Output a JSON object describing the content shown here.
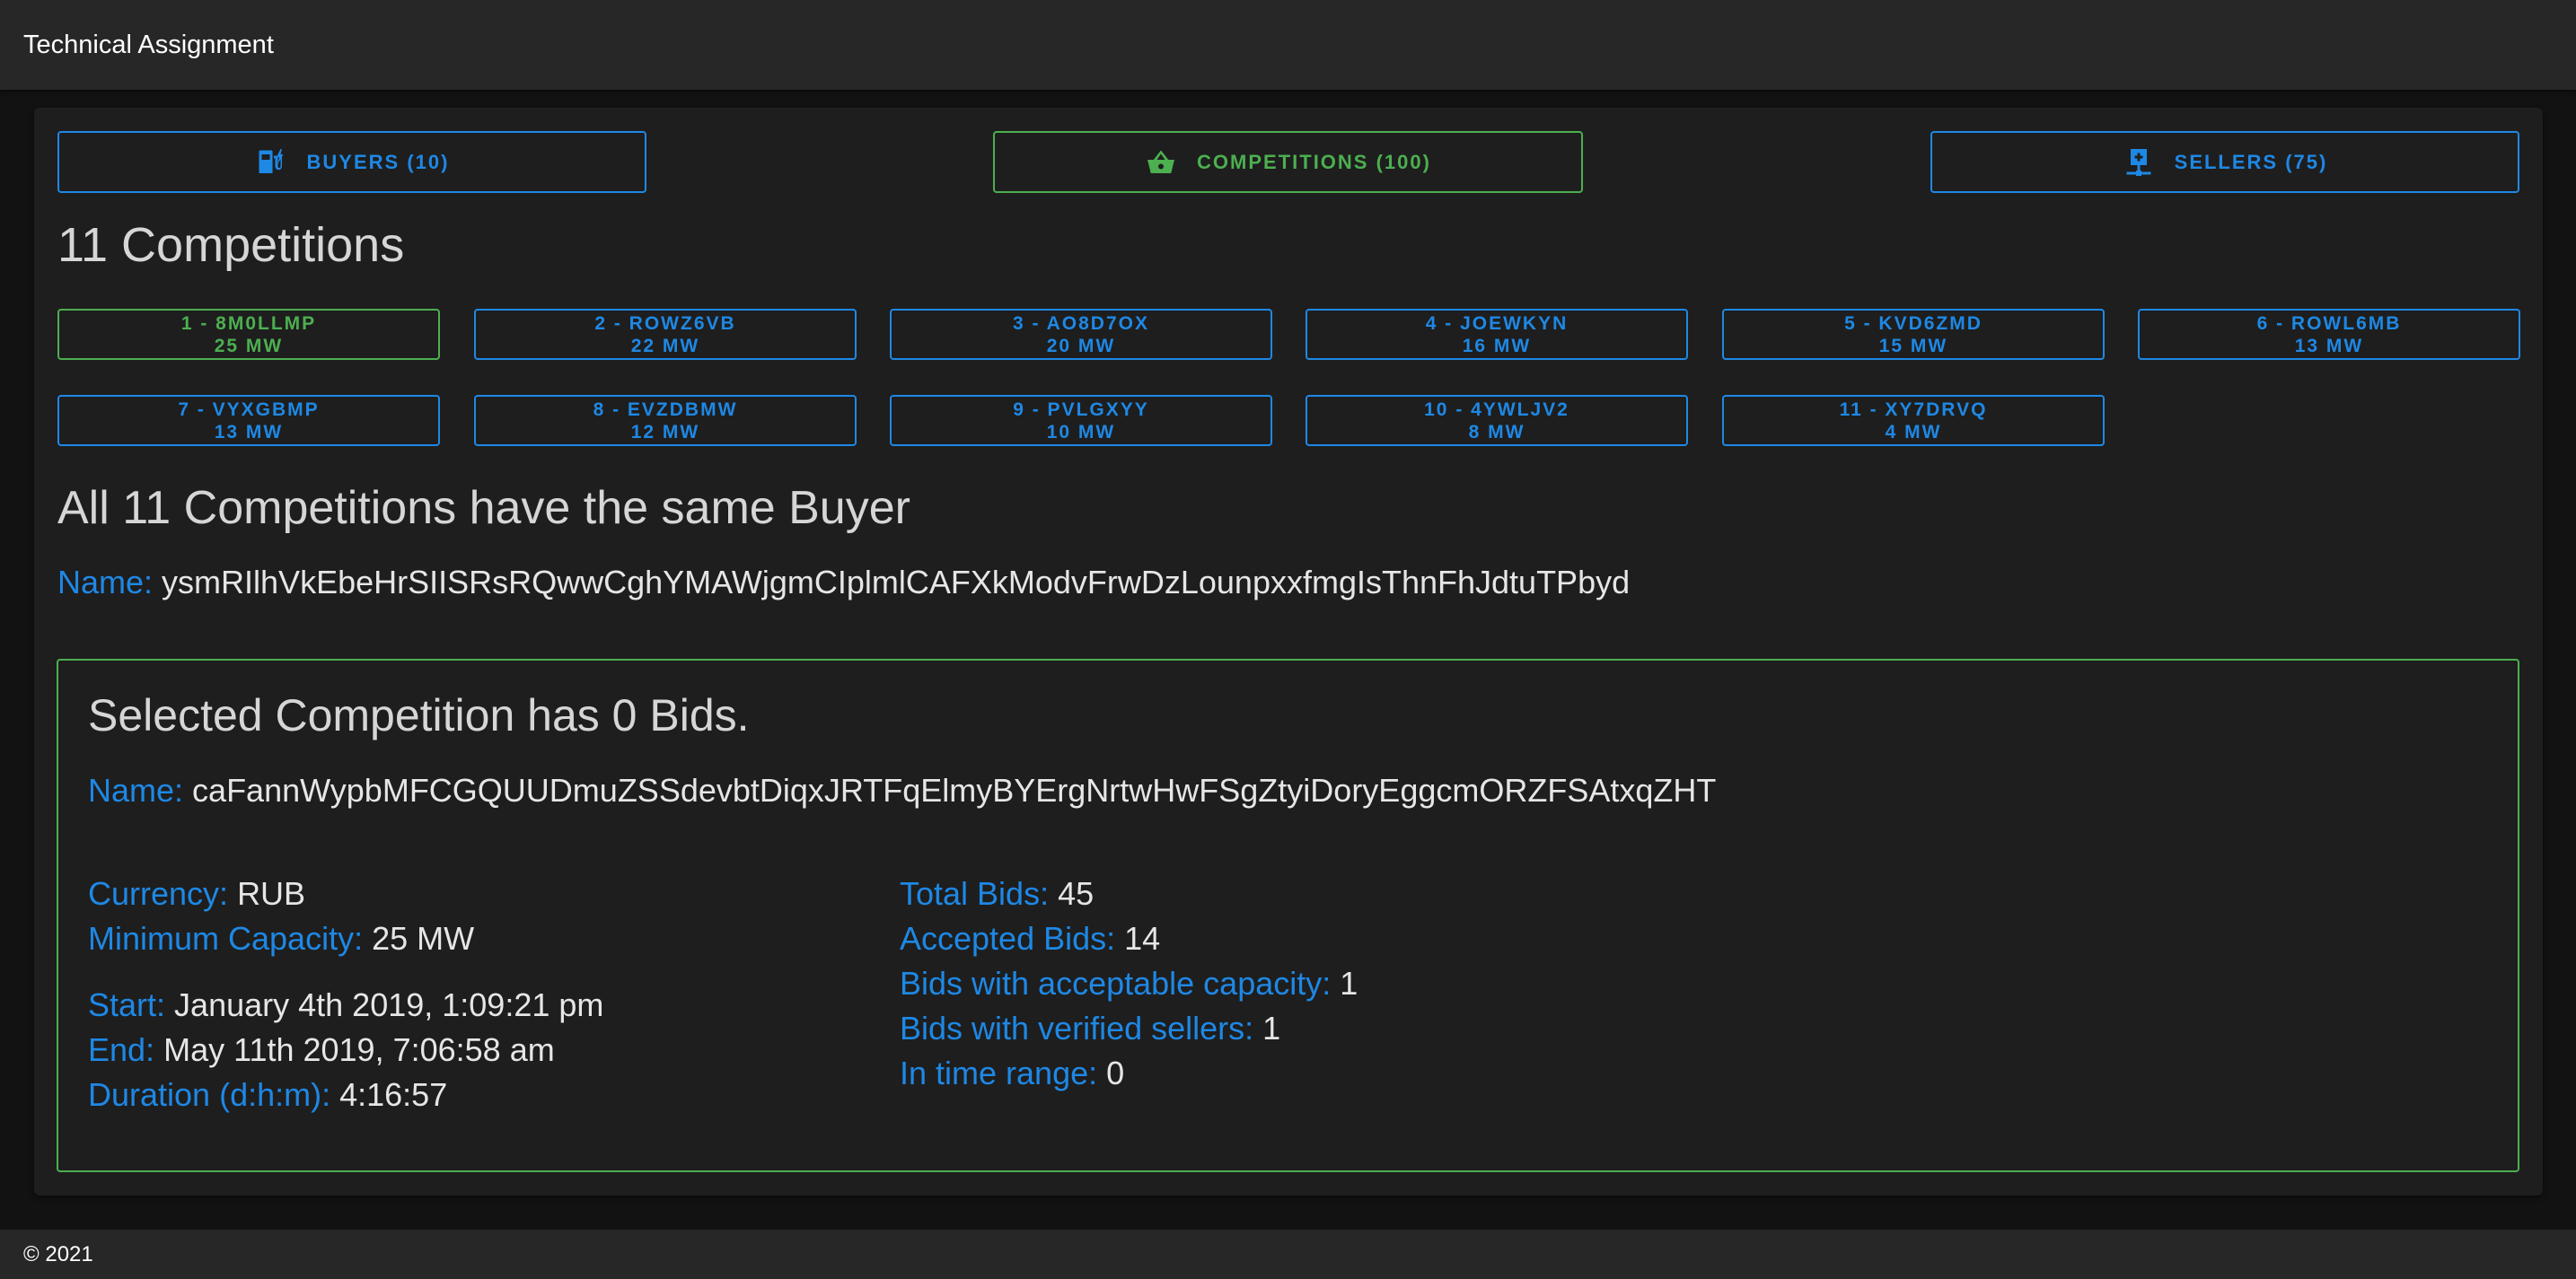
{
  "app": {
    "title": "Technical Assignment"
  },
  "footer": {
    "text": "© 2021"
  },
  "nav": {
    "buyers": {
      "label": "BUYERS (10)",
      "icon": "ev-charger-icon"
    },
    "competitions": {
      "label": "COMPETITIONS (100)",
      "icon": "basket-icon",
      "active": true
    },
    "sellers": {
      "label": "SELLERS (75)",
      "icon": "add-to-network-icon"
    }
  },
  "competitions_heading": "11 Competitions",
  "competitions": [
    {
      "title": "1 - 8M0LLMP",
      "capacity": "25 MW",
      "active": true
    },
    {
      "title": "2 - ROWZ6VB",
      "capacity": "22 MW"
    },
    {
      "title": "3 - AO8D7OX",
      "capacity": "20 MW"
    },
    {
      "title": "4 - JOEWKYN",
      "capacity": "16 MW"
    },
    {
      "title": "5 - KVD6ZMD",
      "capacity": "15 MW"
    },
    {
      "title": "6 - ROWL6MB",
      "capacity": "13 MW"
    },
    {
      "title": "7 - VYXGBMP",
      "capacity": "13 MW"
    },
    {
      "title": "8 - EVZDBMW",
      "capacity": "12 MW"
    },
    {
      "title": "9 - PVLGXYY",
      "capacity": "10 MW"
    },
    {
      "title": "10 - 4YWLJV2",
      "capacity": "8 MW"
    },
    {
      "title": "11 - XY7DRVQ",
      "capacity": "4 MW"
    }
  ],
  "buyer": {
    "heading": "All 11 Competitions have the same Buyer",
    "name_label": "Name:",
    "name_value": "ysmRIlhVkEbeHrSIISRsRQwwCghYMAWjgmCIplmlCAFXkModvFrwDzLounpxxfmgIsThnFhJdtuTPbyd"
  },
  "selected": {
    "heading": "Selected Competition has 0 Bids.",
    "name_label": "Name:",
    "name_value": "caFannWypbMFCGQUUDmuZSSdevbtDiqxJRTFqElmyBYErgNrtwHwFSgZtyiDoryEggcmORZFSAtxqZHT",
    "currency_label": "Currency:",
    "currency_value": "RUB",
    "min_capacity_label": "Minimum Capacity:",
    "min_capacity_value": "25 MW",
    "start_label": "Start:",
    "start_value": "January 4th 2019, 1:09:21 pm",
    "end_label": "End:",
    "end_value": "May 11th 2019, 7:06:58 am",
    "duration_label": "Duration (d:h:m):",
    "duration_value": "4:16:57",
    "total_bids_label": "Total Bids:",
    "total_bids_value": "45",
    "accepted_bids_label": "Accepted Bids:",
    "accepted_bids_value": "14",
    "acceptable_capacity_label": "Bids with acceptable capacity:",
    "acceptable_capacity_value": "1",
    "verified_sellers_label": "Bids with verified sellers:",
    "verified_sellers_value": "1",
    "in_time_label": "In time range:",
    "in_time_value": "0"
  },
  "colors": {
    "accent_blue": "#1e88e5",
    "accent_green": "#4caf50",
    "background": "#121212",
    "surface": "#1e1e1e"
  }
}
